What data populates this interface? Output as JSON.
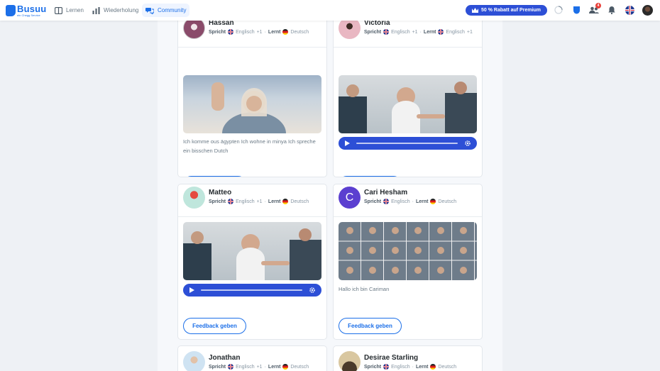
{
  "brand": {
    "name": "Busuu",
    "tagline": "ein Chegg Service"
  },
  "nav": [
    {
      "label": "Lernen",
      "icon": "book-icon",
      "active": false
    },
    {
      "label": "Wiederholung",
      "icon": "bar-chart-icon",
      "active": false
    },
    {
      "label": "Community",
      "icon": "chat-bubbles-icon",
      "active": true
    }
  ],
  "premium": {
    "label": "50 % Rabatt auf Premium",
    "icon": "crown-icon"
  },
  "notifications": {
    "friends_count": "4"
  },
  "labels": {
    "speaks": "Spricht",
    "learns": "Lernt",
    "feedback": "Feedback geben"
  },
  "cards": [
    {
      "name": "Hassan",
      "speaks_lang": "Englisch",
      "speaks_extra": "+1",
      "learns_lang": "Deutsch",
      "text": "Ich komme ous ägypten Ich wohne in minya Ich spreche ein bisschen Dutch"
    },
    {
      "name": "Victoria",
      "speaks_lang": "Englisch",
      "speaks_extra": "+1",
      "learns_lang": "Englisch",
      "learns_extra": "+1",
      "text": ""
    },
    {
      "name": "Matteo",
      "speaks_lang": "Englisch",
      "speaks_extra": "+1",
      "learns_lang": "Deutsch",
      "text": ""
    },
    {
      "name": "Cari Hesham",
      "avatar_letter": "C",
      "speaks_lang": "Englisch",
      "learns_lang": "Deutsch",
      "text": "Hallo ich bin Cariman"
    },
    {
      "name": "Jonathan",
      "speaks_lang": "Englisch",
      "speaks_extra": "+1",
      "learns_lang": "Deutsch",
      "text": ""
    },
    {
      "name": "Desirae Starling",
      "speaks_lang": "Englisch",
      "learns_lang": "Deutsch",
      "text": ""
    }
  ],
  "colors": {
    "accent": "#1c6fe8",
    "premium": "#2d4fd6",
    "avatar_c": "#5b3fd0"
  }
}
